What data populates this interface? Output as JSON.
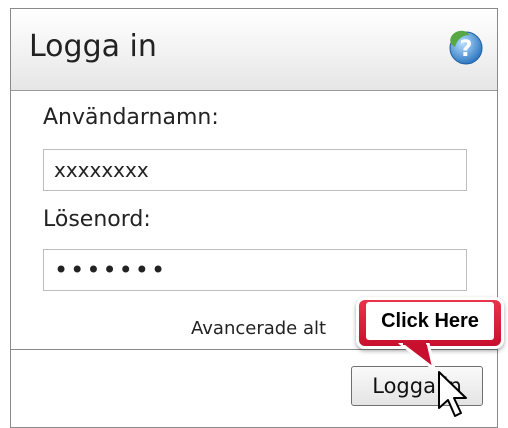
{
  "header": {
    "title": "Logga in",
    "help_icon": "help-question-icon"
  },
  "form": {
    "username_label": "Användarnamn:",
    "username_value": "xxxxxxxx",
    "password_label": "Lösenord:",
    "password_value": "•••••••",
    "advanced_link": "Avancerade alt"
  },
  "footer": {
    "login_button": "Logga in"
  },
  "overlay": {
    "callout_text": "Click Here",
    "cursor_icon": "mouse-pointer-icon"
  },
  "colors": {
    "callout_red": "#d0132f",
    "help_icon_blue": "#3a86c8",
    "help_icon_green": "#57a845"
  }
}
